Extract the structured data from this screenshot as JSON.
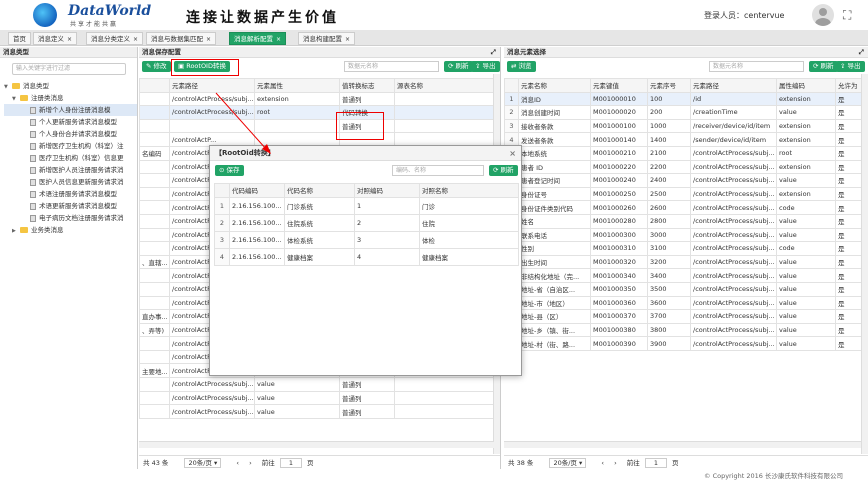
{
  "header": {
    "logo_text": "DataWorld",
    "logo_sub": "共享才能共赢",
    "slogan": "连接让数据产生价值",
    "user_label": "登录人员：centervue"
  },
  "tabs": [
    {
      "label": "首页",
      "closable": false
    },
    {
      "label": "消息定义",
      "closable": true
    },
    {
      "label": "消息分类定义",
      "closable": true
    },
    {
      "label": "消息与数据集匹配",
      "closable": true
    },
    {
      "label": "消息解析配置",
      "closable": true,
      "active": true
    },
    {
      "label": "消息构建配置",
      "closable": true
    }
  ],
  "left": {
    "title": "消息类型",
    "search_placeholder": "输入关键字进行过滤",
    "root": "消息类型",
    "group": "注册类消息",
    "items": [
      "新增个人身份注册消息模",
      "个人更新服务请求消息模型",
      "个人身份合并请求消息模型",
      "新增医疗卫生机构（科室）注",
      "医疗卫生机构（科室）信息更",
      "新增医护人员注册服务请求消",
      "医护人员信息更新服务请求消",
      "术语注册服务请求消息模型",
      "术语更新服务请求消息模型",
      "电子病历文档注册服务请求消"
    ],
    "other_group": "业务类消息"
  },
  "mid": {
    "title": "消息保存配置",
    "edit_label": "修改",
    "rootoid_label": "RootOID转换",
    "search_placeholder": "数据元名称",
    "refresh_label": "刷新",
    "export_label": "导出",
    "columns": [
      "元素路径",
      "元素属性",
      "值转换标志",
      "源表名称"
    ],
    "rows": [
      {
        "left": "",
        "path": "/controlActProcess/subj...",
        "attr": "extension",
        "flag": "普通列"
      },
      {
        "left": "",
        "path": "/controlActProcess/subj...",
        "attr": "root",
        "flag": "代码转换"
      },
      {
        "left": "",
        "path": "",
        "attr": "",
        "flag": "普通列"
      },
      {
        "left": "",
        "path": "/controlActP...",
        "attr": "",
        "flag": ""
      },
      {
        "left": "名编码",
        "path": "/controlActP...",
        "attr": "",
        "flag": ""
      },
      {
        "left": "",
        "path": "/controlActP...",
        "attr": "",
        "flag": ""
      },
      {
        "left": "",
        "path": "/controlActP...",
        "attr": "",
        "flag": ""
      },
      {
        "left": "",
        "path": "/controlActP...",
        "attr": "",
        "flag": ""
      },
      {
        "left": "",
        "path": "/controlActP...",
        "attr": "",
        "flag": ""
      },
      {
        "left": "",
        "path": "/controlActP...",
        "attr": "",
        "flag": ""
      },
      {
        "left": "",
        "path": "/controlActP...",
        "attr": "",
        "flag": ""
      },
      {
        "left": "",
        "path": "/controlActP...",
        "attr": "",
        "flag": ""
      },
      {
        "left": "、直辖...",
        "path": "/controlActP...",
        "attr": "",
        "flag": ""
      },
      {
        "left": "",
        "path": "/controlActP...",
        "attr": "",
        "flag": ""
      },
      {
        "left": "",
        "path": "/controlActP...",
        "attr": "",
        "flag": ""
      },
      {
        "left": "",
        "path": "/controlActP...",
        "attr": "",
        "flag": ""
      },
      {
        "left": "直办事...",
        "path": "/controlActP...",
        "attr": "",
        "flag": ""
      },
      {
        "left": "、弄等)",
        "path": "/controlActP...",
        "attr": "",
        "flag": ""
      },
      {
        "left": "",
        "path": "/controlActProcess/subj...",
        "attr": "value",
        "flag": "普通列"
      },
      {
        "left": "",
        "path": "/controlActProcess/subj...",
        "attr": "value",
        "flag": "普通列"
      },
      {
        "left": "主要地...",
        "path": "/controlActProcess/subj...",
        "attr": "value",
        "flag": "普通列"
      },
      {
        "left": "",
        "path": "/controlActProcess/subj...",
        "attr": "value",
        "flag": "普通列"
      },
      {
        "left": "",
        "path": "/controlActProcess/subj...",
        "attr": "value",
        "flag": "普通列"
      },
      {
        "left": "",
        "path": "/controlActProcess/subj...",
        "attr": "value",
        "flag": "普通列"
      }
    ],
    "footer": {
      "total": "共 43 条",
      "page_size": "20条/页",
      "goto": "前往",
      "page": "1",
      "page_unit": "页"
    }
  },
  "dialog": {
    "title": "【RootOid转换】",
    "save_label": "保存",
    "search_placeholder": "编码、名称",
    "refresh_label": "刷新",
    "columns": [
      "代码编码",
      "代码名称",
      "对照编码",
      "对照名称"
    ],
    "rows": [
      {
        "n": "1",
        "code": "2.16.156.100...",
        "name": "门诊系统",
        "map_code": "1",
        "map_name": "门诊"
      },
      {
        "n": "2",
        "code": "2.16.156.100...",
        "name": "住院系统",
        "map_code": "2",
        "map_name": "住院"
      },
      {
        "n": "3",
        "code": "2.16.156.100...",
        "name": "体检系统",
        "map_code": "3",
        "map_name": "体检"
      },
      {
        "n": "4",
        "code": "2.16.156.100...",
        "name": "健康档案",
        "map_code": "4",
        "map_name": "健康档案"
      }
    ]
  },
  "right": {
    "title": "消息元素选择",
    "browse_label": "浏览",
    "search_placeholder": "数据元名称",
    "refresh_label": "刷新",
    "export_label": "导出",
    "columns": [
      "",
      "元素名称",
      "元素键值",
      "元素序号",
      "元素路径",
      "属性编码",
      "允许为"
    ],
    "rows": [
      {
        "n": "1",
        "name": "消息ID",
        "key": "M001000010",
        "seq": "100",
        "path": "/id",
        "attr": "extension",
        "allow": "是"
      },
      {
        "n": "2",
        "name": "消息创建时间",
        "key": "M001000020",
        "seq": "200",
        "path": "/creationTime",
        "attr": "value",
        "allow": "是"
      },
      {
        "n": "3",
        "name": "接收者条款",
        "key": "M001000100",
        "seq": "1000",
        "path": "/receiver/device/id/item",
        "attr": "extension",
        "allow": "是"
      },
      {
        "n": "4",
        "name": "发送者条款",
        "key": "M001000140",
        "seq": "1400",
        "path": "/sender/device/id/item",
        "attr": "extension",
        "allow": "是"
      },
      {
        "n": "5",
        "name": "本地系统",
        "key": "M001000210",
        "seq": "2100",
        "path": "/controlActProcess/subj...",
        "attr": "root",
        "allow": "是"
      },
      {
        "n": "6",
        "name": "患者 ID",
        "key": "M001000220",
        "seq": "2200",
        "path": "/controlActProcess/subj...",
        "attr": "extension",
        "allow": "是"
      },
      {
        "n": "7",
        "name": "患者登记时间",
        "key": "M001000240",
        "seq": "2400",
        "path": "/controlActProcess/subj...",
        "attr": "value",
        "allow": "是"
      },
      {
        "n": "8",
        "name": "身份证号",
        "key": "M001000250",
        "seq": "2500",
        "path": "/controlActProcess/subj...",
        "attr": "extension",
        "allow": "是"
      },
      {
        "n": "9",
        "name": "身份证件类别代码",
        "key": "M001000260",
        "seq": "2600",
        "path": "/controlActProcess/subj...",
        "attr": "code",
        "allow": "是"
      },
      {
        "n": "10",
        "name": "姓名",
        "key": "M001000280",
        "seq": "2800",
        "path": "/controlActProcess/subj...",
        "attr": "value",
        "allow": "是"
      },
      {
        "n": "11",
        "name": "联系电话",
        "key": "M001000300",
        "seq": "3000",
        "path": "/controlActProcess/subj...",
        "attr": "value",
        "allow": "是"
      },
      {
        "n": "12",
        "name": "性别",
        "key": "M001000310",
        "seq": "3100",
        "path": "/controlActProcess/subj...",
        "attr": "code",
        "allow": "是"
      },
      {
        "n": "13",
        "name": "出生时间",
        "key": "M001000320",
        "seq": "3200",
        "path": "/controlActProcess/subj...",
        "attr": "value",
        "allow": "是"
      },
      {
        "n": "14",
        "name": "非结构化地址（完...",
        "key": "M001000340",
        "seq": "3400",
        "path": "/controlActProcess/subj...",
        "attr": "value",
        "allow": "是"
      },
      {
        "n": "15",
        "name": "地址-省（自治区...",
        "key": "M001000350",
        "seq": "3500",
        "path": "/controlActProcess/subj...",
        "attr": "value",
        "allow": "是"
      },
      {
        "n": "16",
        "name": "地址-市（地区）",
        "key": "M001000360",
        "seq": "3600",
        "path": "/controlActProcess/subj...",
        "attr": "value",
        "allow": "是"
      },
      {
        "n": "17",
        "name": "地址-县（区）",
        "key": "M001000370",
        "seq": "3700",
        "path": "/controlActProcess/subj...",
        "attr": "value",
        "allow": "是"
      },
      {
        "n": "18",
        "name": "地址-乡（镇、街...",
        "key": "M001000380",
        "seq": "3800",
        "path": "/controlActProcess/subj...",
        "attr": "value",
        "allow": "是"
      },
      {
        "n": "19",
        "name": "地址-村（街、路...",
        "key": "M001000390",
        "seq": "3900",
        "path": "/controlActProcess/subj...",
        "attr": "value",
        "allow": "是"
      }
    ],
    "footer": {
      "total": "共 38 条",
      "page_size": "20条/页",
      "goto": "前往",
      "page": "1",
      "page_unit": "页"
    }
  },
  "copyright": "© Copyright 2016 长沙康氏软件科技有限公司",
  "colors": {
    "accent": "#21a366",
    "highlight": "#e00000"
  }
}
